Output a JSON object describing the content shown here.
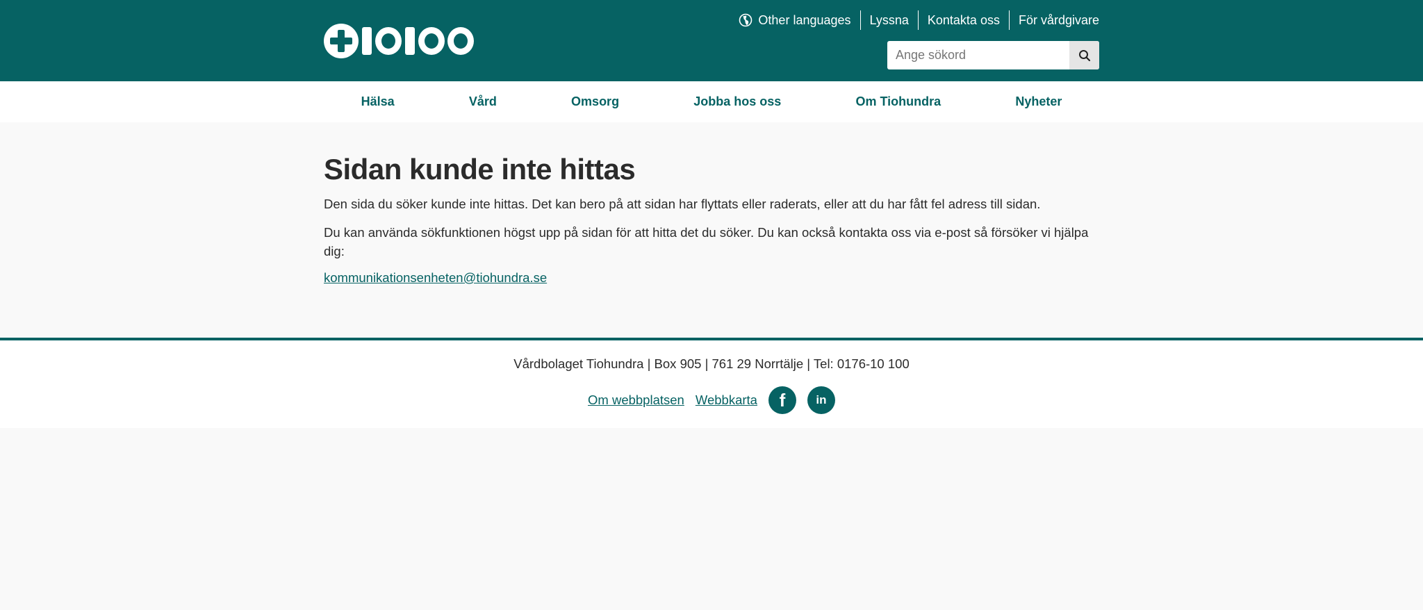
{
  "header": {
    "utility_nav": [
      {
        "label": "Other languages",
        "icon": "globe-icon"
      },
      {
        "label": "Lyssna"
      },
      {
        "label": "Kontakta oss"
      },
      {
        "label": "För vårdgivare"
      }
    ],
    "search": {
      "placeholder": "Ange sökord",
      "button_icon": "search-icon"
    }
  },
  "main_nav": [
    {
      "label": "Hälsa"
    },
    {
      "label": "Vård"
    },
    {
      "label": "Omsorg"
    },
    {
      "label": "Jobba hos oss"
    },
    {
      "label": "Om Tiohundra"
    },
    {
      "label": "Nyheter"
    }
  ],
  "content": {
    "title": "Sidan kunde inte hittas",
    "paragraph1": "Den sida du söker kunde inte hittas. Det kan bero på att sidan har flyttats eller raderats, eller att du har fått fel adress till sidan.",
    "paragraph2": "Du kan använda sökfunktionen högst upp på sidan för att hitta det du söker. Du kan också kontakta oss via e-post så försöker vi hjälpa dig:",
    "email": "kommunikationsenheten@tiohundra.se"
  },
  "footer": {
    "address": "Vårdbolaget Tiohundra | Box 905 | 761 29 Norrtälje | Tel: 0176-10 100",
    "links": [
      {
        "label": "Om webbplatsen"
      },
      {
        "label": "Webbkarta"
      }
    ],
    "social": [
      {
        "icon": "facebook-icon",
        "glyph": "f"
      },
      {
        "icon": "linkedin-icon",
        "glyph": "in"
      }
    ]
  },
  "colors": {
    "brand": "#066263",
    "background": "#f9f9f9",
    "text": "#2b2b2b"
  }
}
